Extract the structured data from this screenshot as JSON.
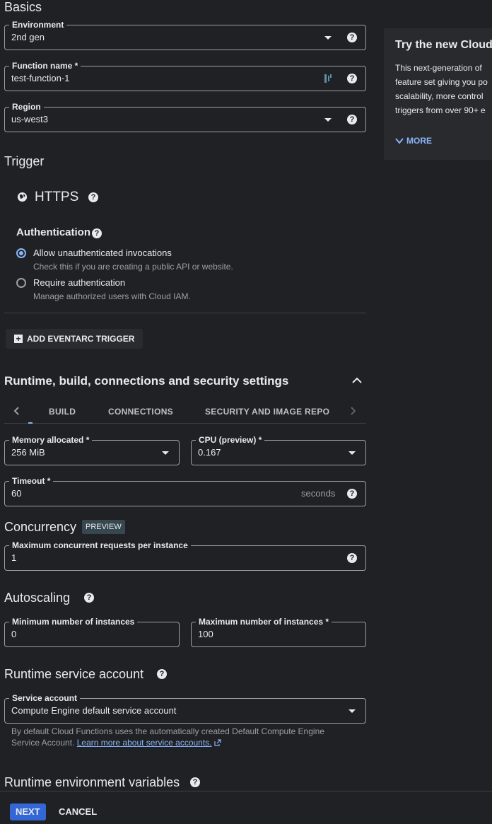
{
  "basics": {
    "heading": "Basics",
    "environment": {
      "label": "Environment",
      "value": "2nd gen"
    },
    "function_name": {
      "label": "Function name *",
      "value": "test-function-1"
    },
    "region": {
      "label": "Region",
      "value": "us-west3"
    }
  },
  "side_panel": {
    "title": "Try the new Cloud",
    "body_lines": [
      "This next-generation of",
      "feature set giving you po",
      "scalability, more control",
      "triggers from over 90+ e"
    ],
    "more_label": "MORE"
  },
  "trigger": {
    "heading": "Trigger",
    "type": "HTTPS",
    "auth_heading": "Authentication",
    "options": [
      {
        "label": "Allow unauthenticated invocations",
        "desc": "Check this if you are creating a public API or website.",
        "selected": true
      },
      {
        "label": "Require authentication",
        "desc": "Manage authorized users with Cloud IAM.",
        "selected": false
      }
    ],
    "add_eventarc_label": "ADD EVENTARC TRIGGER"
  },
  "runtime": {
    "heading": "Runtime, build, connections and security settings",
    "tabs": [
      "BUILD",
      "CONNECTIONS",
      "SECURITY AND IMAGE REPO"
    ],
    "memory": {
      "label": "Memory allocated *",
      "value": "256 MiB"
    },
    "cpu": {
      "label": "CPU (preview) *",
      "value": "0.167"
    },
    "timeout": {
      "label": "Timeout *",
      "value": "60",
      "suffix": "seconds"
    },
    "concurrency": {
      "heading": "Concurrency",
      "badge": "PREVIEW",
      "field": {
        "label": "Maximum concurrent requests per instance",
        "value": "1"
      }
    },
    "autoscaling": {
      "heading": "Autoscaling",
      "min": {
        "label": "Minimum number of instances",
        "value": "0"
      },
      "max": {
        "label": "Maximum number of instances *",
        "value": "100"
      }
    },
    "service_account": {
      "heading": "Runtime service account",
      "label": "Service account",
      "value": "Compute Engine default service account",
      "help_line1": "By default Cloud Functions uses the automatically created Default Compute Engine",
      "help_line2": "Service Account.",
      "help_link": "Learn more about service accounts."
    },
    "env_vars_heading": "Runtime environment variables"
  },
  "footer": {
    "next_label": "NEXT",
    "cancel_label": "CANCEL"
  },
  "colors": {
    "background": "#202124",
    "accent": "#8ab4f8",
    "primary_button": "#3367d6"
  }
}
